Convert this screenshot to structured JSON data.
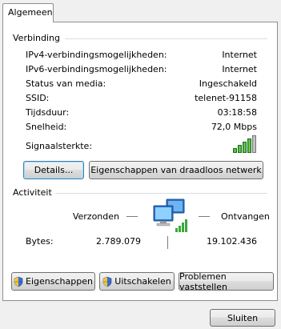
{
  "tab": {
    "label": "Algemeen"
  },
  "connection": {
    "title": "Verbinding",
    "rows": [
      {
        "label": "IPv4-verbindingsmogelijkheden:",
        "value": "Internet"
      },
      {
        "label": "IPv6-verbindingsmogelijkheden:",
        "value": "Internet"
      },
      {
        "label": "Status van media:",
        "value": "Ingeschakeld"
      },
      {
        "label": "SSID:",
        "value": "telenet-91158"
      },
      {
        "label": "Tijdsduur:",
        "value": "03:18:58"
      },
      {
        "label": "Snelheid:",
        "value": "72,0 Mbps"
      }
    ],
    "signal_label": "Signaalsterkte:",
    "signal_bars_filled": 4,
    "signal_bars_total": 5,
    "details_button": "Details...",
    "wireless_props_button": "Eigenschappen van draadloos netwerk"
  },
  "activity": {
    "title": "Activiteit",
    "sent_label": "Verzonden",
    "received_label": "Ontvangen",
    "bytes_label": "Bytes:",
    "bytes_sent": "2.789.079",
    "bytes_received": "19.102.436"
  },
  "buttons": {
    "properties": "Eigenschappen",
    "disable": "Uitschakelen",
    "diagnose": "Problemen vaststellen",
    "close": "Sluiten"
  },
  "icons": {
    "network": "network-computers-icon",
    "signal": "signal-strength-icon",
    "shield": "uac-shield-icon"
  }
}
